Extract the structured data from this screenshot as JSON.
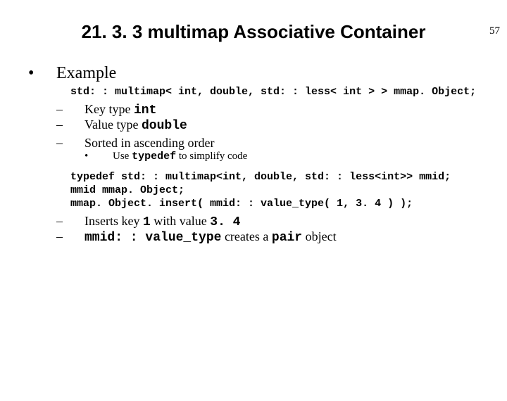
{
  "page_number": "57",
  "title": "21. 3. 3 multimap Associative Container",
  "lvl1": {
    "example": "Example"
  },
  "code1": "std: : multimap< int, double, std: : less< int > > mmap. Object;",
  "lvl2": {
    "keytype_pre": "Key type ",
    "keytype_code": "int",
    "valuetype_pre": "Value type ",
    "valuetype_code": "double",
    "sorted": "Sorted in ascending order",
    "inserts_pre": "Inserts key ",
    "inserts_k": "1",
    "inserts_mid": " with value ",
    "inserts_v": "3. 4",
    "mmid_code": "mmid: : value_type",
    "mmid_mid": " creates a ",
    "mmid_pair": "pair",
    "mmid_post": " object"
  },
  "lvl3": {
    "use_pre": "Use ",
    "use_code": "typedef",
    "use_post": " to simplify code"
  },
  "codeblock": {
    "l1": "typedef std: : multimap<int, double, std: : less<int>> mmid;",
    "l2": "mmid mmap. Object;",
    "l3": "mmap. Object. insert( mmid: : value_type( 1, 3. 4 ) );"
  }
}
